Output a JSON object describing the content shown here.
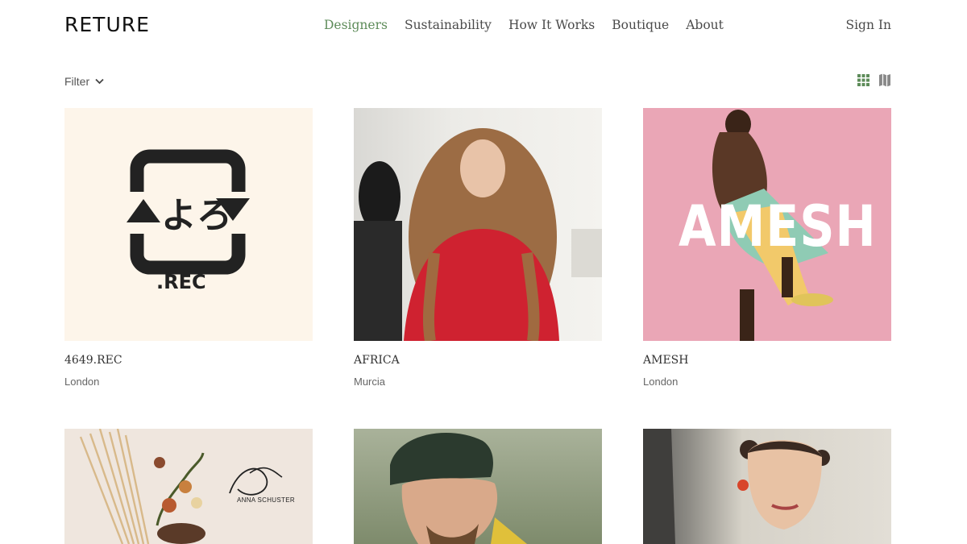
{
  "brand": {
    "logo": "RETURE"
  },
  "nav": {
    "items": [
      {
        "label": "Designers",
        "active": true
      },
      {
        "label": "Sustainability",
        "active": false
      },
      {
        "label": "How It Works",
        "active": false
      },
      {
        "label": "Boutique",
        "active": false
      },
      {
        "label": "About",
        "active": false
      }
    ],
    "sign_in": "Sign In"
  },
  "toolbar": {
    "filter_label": "Filter",
    "view_icons": [
      "grid-view-icon",
      "map-view-icon"
    ]
  },
  "designers": [
    {
      "name": "4649.REC",
      "city": "London",
      "image_text": ".REC"
    },
    {
      "name": "AFRICA",
      "city": "Murcia"
    },
    {
      "name": "AMESH",
      "city": "London",
      "image_text": "AMESH"
    },
    {
      "name": "",
      "city": "",
      "image_text": "ANNA SCHUSTER"
    },
    {
      "name": "",
      "city": ""
    },
    {
      "name": "",
      "city": ""
    }
  ],
  "colors": {
    "accent": "#5e8c5a",
    "text": "#4a4a4a",
    "rec_bg": "#fdf5ea",
    "amesh_bg": "#eaa6b6"
  }
}
